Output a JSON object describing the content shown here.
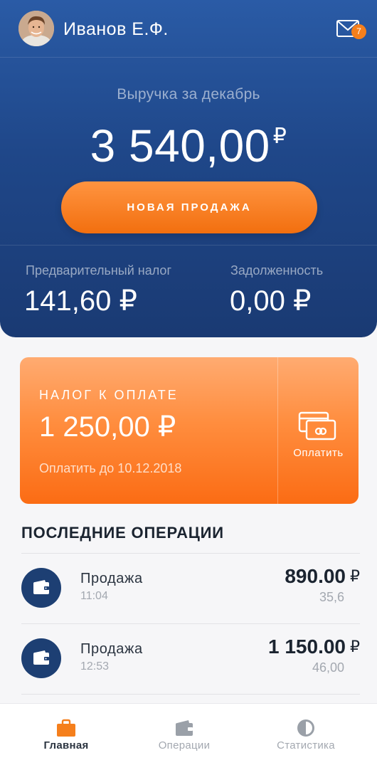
{
  "header": {
    "user_name": "Иванов Е.Ф.",
    "mail_badge": "7"
  },
  "revenue": {
    "label": "Выручка за декабрь",
    "amount": "3 540,00",
    "currency": "₽"
  },
  "new_sale_label": "НОВАЯ ПРОДАЖА",
  "stats": {
    "prelim_tax_label": "Предварительный налог",
    "prelim_tax_value": "141,60 ₽",
    "debt_label": "Задолженность",
    "debt_value": "0,00 ₽"
  },
  "tax_card": {
    "title": "НАЛОГ К ОПЛАТЕ",
    "amount": "1 250,00 ₽",
    "due": "Оплатить до 10.12.2018",
    "pay_label": "Оплатить"
  },
  "recent": {
    "title": "ПОСЛЕДНИЕ ОПЕРАЦИИ",
    "items": [
      {
        "title": "Продажа",
        "time": "11:04",
        "amount": "890.00",
        "currency": "₽",
        "tax": "35,6"
      },
      {
        "title": "Продажа",
        "time": "12:53",
        "amount": "1 150.00",
        "currency": "₽",
        "tax": "46,00"
      }
    ]
  },
  "tabs": [
    {
      "label": "Главная",
      "icon": "briefcase-icon",
      "active": true
    },
    {
      "label": "Операции",
      "icon": "wallet-icon",
      "active": false
    },
    {
      "label": "Статистика",
      "icon": "pie-chart-icon",
      "active": false
    }
  ],
  "colors": {
    "hero_blue": "#1f4789",
    "accent_orange": "#f57f1c",
    "dark_text": "#1b2430"
  }
}
